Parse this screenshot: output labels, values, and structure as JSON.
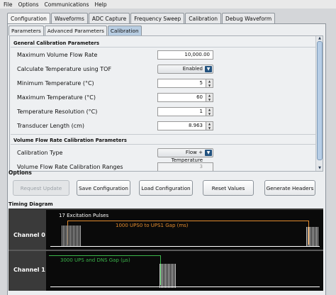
{
  "menubar": {
    "items": [
      "File",
      "Options",
      "Communications",
      "Help"
    ]
  },
  "top_tabs": [
    "Configuration",
    "Waveforms",
    "ADC Capture",
    "Frequency Sweep",
    "Calibration",
    "Debug Waveform"
  ],
  "sub_tabs": [
    "Parameters",
    "Advanced Parameters",
    "Calibration"
  ],
  "general": {
    "header": "General Calibration Parameters",
    "rows": [
      {
        "label": "Maximum Volume Flow Rate",
        "value": "10,000.00"
      },
      {
        "label": "Calculate Temperature using TOF",
        "value": "Enabled"
      },
      {
        "label": "Minimum Temperature (°C)",
        "value": "5"
      },
      {
        "label": "Maximum Temperature (°C)",
        "value": "60"
      },
      {
        "label": "Temperature Resolution (°C)",
        "value": "1"
      },
      {
        "label": "Transducer Length (cm)",
        "value": "8.963"
      }
    ]
  },
  "vfr": {
    "header": "Volume Flow Rate Calibration Parameters",
    "rows": [
      {
        "label": "Calibration Type",
        "value": "Flow + Temperature"
      },
      {
        "label": "Volume Flow Rate Calibration Ranges",
        "value": "3"
      }
    ]
  },
  "options": {
    "label": "Options",
    "buttons": [
      "Request Update",
      "Save Configuration",
      "Load Configuration",
      "Reset Values",
      "Generate Headers"
    ]
  },
  "timing": {
    "label": "Timing Diagram",
    "channel0": "Channel 0",
    "channel1": "Channel 1",
    "excitation": "17 Excitation Pulses",
    "gap0": "1000 UPS0 to UPS1 Gap (ms)",
    "gap1": "3000 UPS and DNS Gap (µs)"
  },
  "colors": {
    "orange": "#e08a2e",
    "green": "#3bb54a"
  }
}
